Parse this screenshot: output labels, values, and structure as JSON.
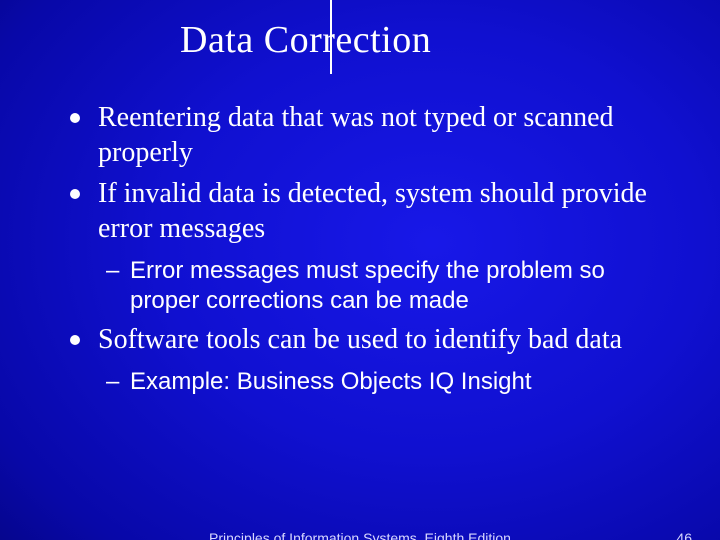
{
  "slide": {
    "title": "Data Correction",
    "bullets": [
      {
        "text": "Reentering data that was not typed or scanned properly",
        "sub": []
      },
      {
        "text": "If invalid data is detected, system should provide error messages",
        "sub": [
          "Error messages must specify the problem so proper corrections can be made"
        ]
      },
      {
        "text": "Software tools can be used to identify bad data",
        "sub": [
          "Example: Business Objects IQ Insight"
        ]
      }
    ],
    "footer_center": "Principles of Information Systems, Eighth Edition",
    "page_number": "46"
  }
}
